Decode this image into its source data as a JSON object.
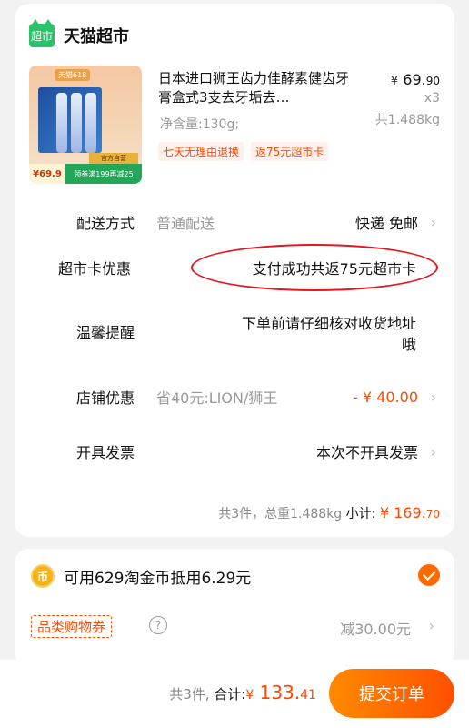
{
  "store": {
    "logo_text": "超市",
    "name": "天猫超市"
  },
  "product": {
    "title": "日本进口狮王齿力佳酵素健齿牙膏盒式3支去牙垢去…",
    "spec": "净含量:130g;",
    "price_symbol": "¥",
    "price_int": "69.",
    "price_dec": "90",
    "qty": "x3",
    "weight": "共1.488kg",
    "tags": [
      "七天无理由退换",
      "返75元超市卡"
    ],
    "thumb": {
      "badge": "天猫618",
      "price": "¥69.9",
      "coupon": "领券满199再减25",
      "gold": "官方自营"
    }
  },
  "rows": {
    "delivery": {
      "label": "配送方式",
      "mid": "普通配送",
      "value": "快递 免邮"
    },
    "card": {
      "label": "超市卡优惠",
      "value": "支付成功共返75元超市卡"
    },
    "reminder": {
      "label": "温馨提醒",
      "value_line1": "下单前请仔细核对收货地址",
      "value_line2": "哦"
    },
    "shop_discount": {
      "label": "店铺优惠",
      "mid": "省40元:LION/狮王",
      "value": "- ¥ 40.00"
    },
    "invoice": {
      "label": "开具发票",
      "value": "本次不开具发票"
    }
  },
  "summary": {
    "text": "共3件，总重1.488kg",
    "subtotal_label": "小计:",
    "symbol": "¥",
    "amount_int": "169.",
    "amount_dec": "70"
  },
  "coins": {
    "icon": "币",
    "text": "可用629淘金币抵用6.29元"
  },
  "coupon": {
    "label": "品类购物券",
    "discount": "减30.00元"
  },
  "bottom": {
    "count": "共3件,",
    "total_label": "合计:",
    "symbol": "¥",
    "total_int": "133.",
    "total_dec": "41",
    "submit": "提交订单"
  },
  "colors": {
    "accent": "#ff4800",
    "highlight_ring": "#e3161f",
    "store_green": "#2bc26a"
  },
  "icons": {
    "chevron": "chevron-right-icon",
    "check": "check-circle-icon",
    "help": "question-icon",
    "coin": "coin-icon"
  }
}
